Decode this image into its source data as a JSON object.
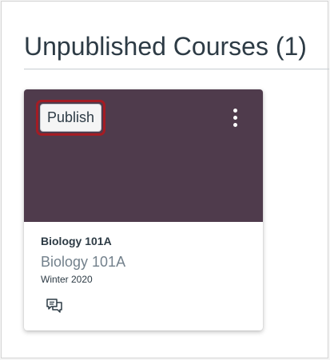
{
  "section": {
    "title": "Unpublished Courses (1)"
  },
  "card": {
    "publish_label": "Publish",
    "hero_color": "#4f3b4c",
    "highlight_color": "#a41c24",
    "course_name": "Biology 101A",
    "course_code": "Biology 101A",
    "term": "Winter 2020",
    "menu_icon": "kebab-menu-icon",
    "action_icon": "discussions-icon"
  }
}
